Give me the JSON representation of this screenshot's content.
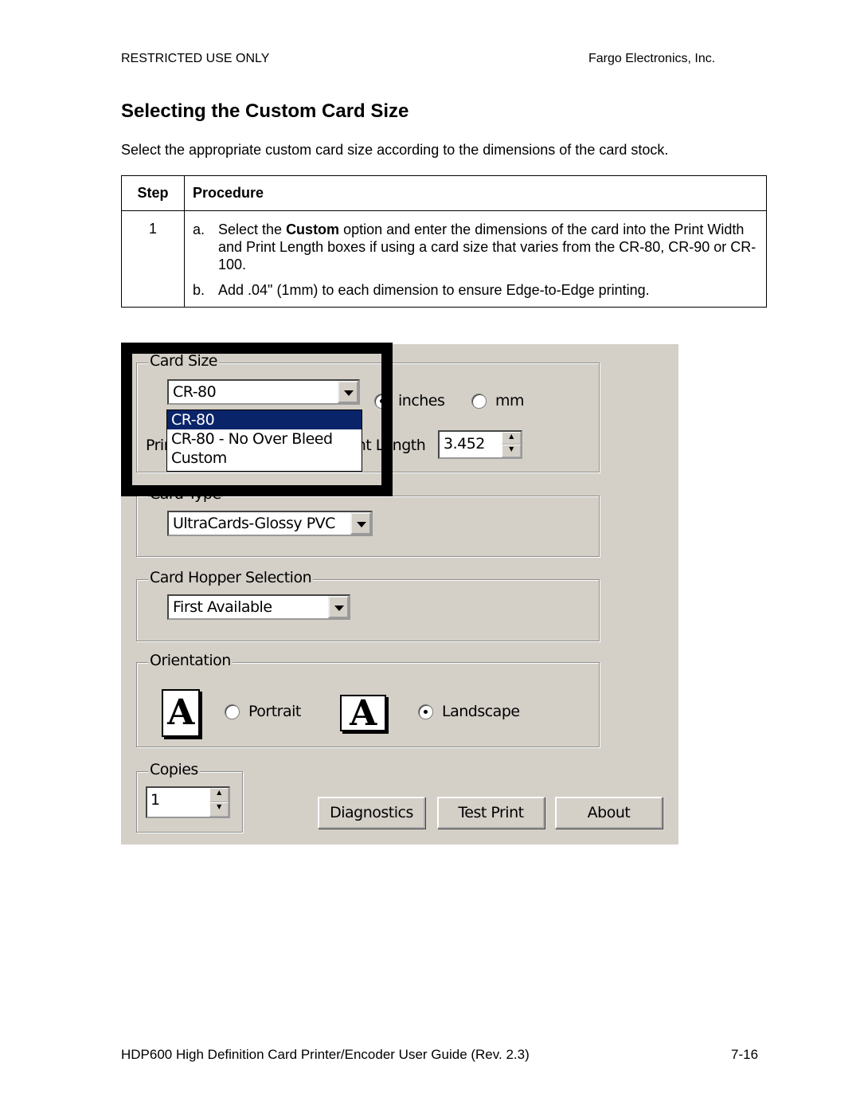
{
  "header": {
    "left": "RESTRICTED USE ONLY",
    "right": "Fargo Electronics, Inc."
  },
  "title": "Selecting the Custom Card Size",
  "intro": "Select the appropriate custom card size according to the dimensions of the card stock.",
  "table": {
    "headers": [
      "Step",
      "Procedure"
    ],
    "rows": [
      {
        "step": "1",
        "items": [
          {
            "letter": "a.",
            "pre": "Select the ",
            "bold": "Custom",
            "post": " option and enter the dimensions of the card into the Print Width and Print Length boxes if using a card size that varies from the CR-80, CR-90 or CR-100."
          },
          {
            "letter": "b.",
            "text": "Add .04\" (1mm) to each dimension to ensure Edge-to-Edge printing."
          }
        ]
      }
    ]
  },
  "dialog": {
    "card_size": {
      "label": "Card Size",
      "selected": "CR-80",
      "options": [
        "CR-80",
        "CR-80 - No Over Bleed",
        "Custom"
      ],
      "units": [
        {
          "label": "inches",
          "checked": true
        },
        {
          "label": "mm",
          "checked": false
        }
      ],
      "print_width_label": "Print Width",
      "print_length_label": "Print Length",
      "print_length_value": "3.452"
    },
    "card_type": {
      "label": "Card Type",
      "selected": "UltraCards-Glossy PVC"
    },
    "hopper": {
      "label": "Card Hopper Selection",
      "selected": "First Available"
    },
    "orientation": {
      "label": "Orientation",
      "options": [
        {
          "label": "Portrait",
          "checked": false
        },
        {
          "label": "Landscape",
          "checked": true
        }
      ],
      "icon_letter": "A"
    },
    "copies": {
      "label": "Copies",
      "value": "1"
    },
    "buttons": {
      "diagnostics": "Diagnostics",
      "test_print": "Test Print",
      "about": "About"
    }
  },
  "footer": {
    "left": "HDP600 High Definition Card Printer/Encoder User Guide (Rev. 2.3)",
    "right": "7-16"
  }
}
